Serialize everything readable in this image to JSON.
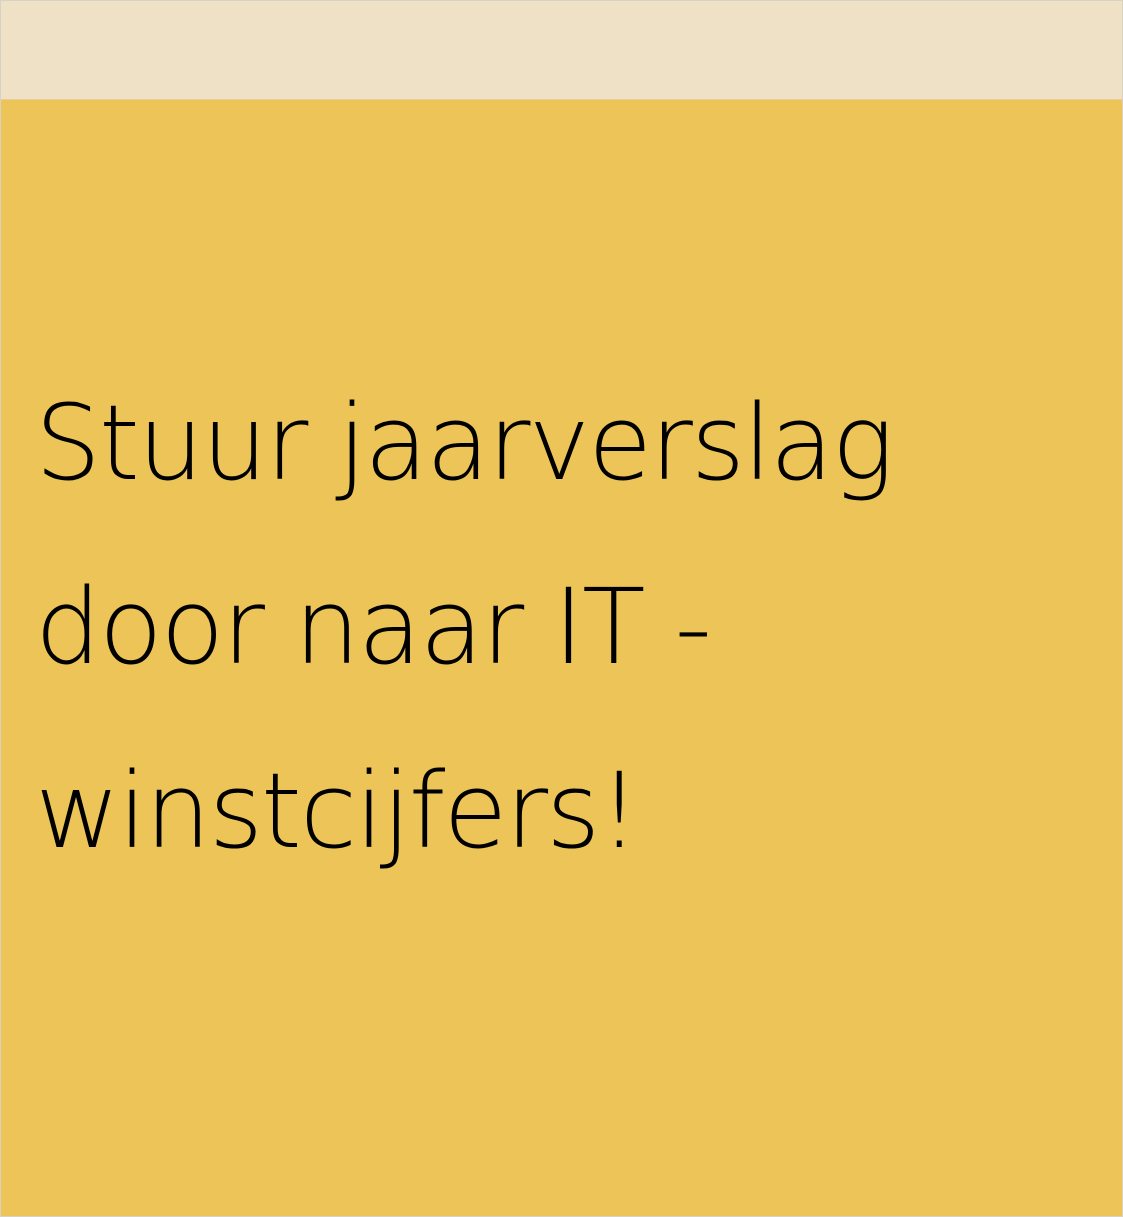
{
  "note": {
    "colors": {
      "header": "#efe1c5",
      "body": "#ecc457",
      "text": "#000000"
    },
    "text_lines": [
      "Stuur jaarverslag",
      "door naar IT -",
      "winstcijfers!"
    ]
  }
}
